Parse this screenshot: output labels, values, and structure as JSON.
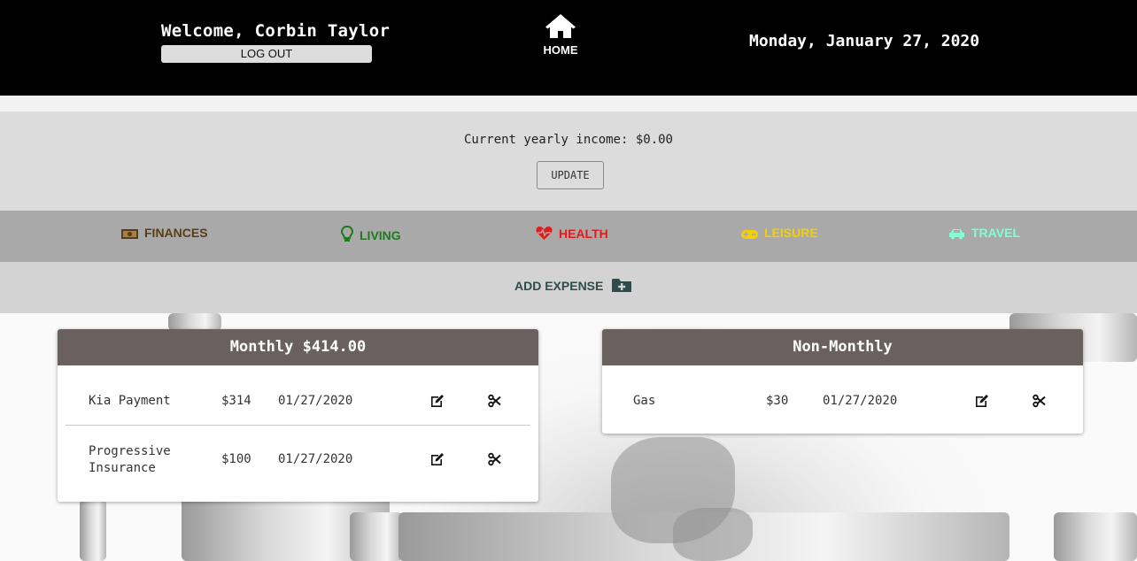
{
  "header": {
    "welcome": "Welcome, Corbin Taylor",
    "logout_label": "LOG OUT",
    "home_label": "HOME",
    "date": "Monday, January 27, 2020"
  },
  "income": {
    "text": "Current yearly income: $0.00",
    "update_label": "UPDATE"
  },
  "categories": [
    {
      "label": "FINANCES",
      "icon": "money-icon",
      "color": "#5a3d14"
    },
    {
      "label": "LIVING",
      "icon": "lightbulb-icon",
      "color": "#1f7a1f"
    },
    {
      "label": "HEALTH",
      "icon": "heartbeat-icon",
      "color": "#e31b1b"
    },
    {
      "label": "LEISURE",
      "icon": "gamepad-icon",
      "color": "#f5d000"
    },
    {
      "label": "TRAVEL",
      "icon": "car-icon",
      "color": "#7fffd4"
    }
  ],
  "add_expense_label": "ADD EXPENSE",
  "monthly": {
    "title": "Monthly $414.00",
    "rows": [
      {
        "name": "Kia Payment",
        "amount": "$314",
        "date": "01/27/2020"
      },
      {
        "name": "Progressive Insurance",
        "amount": "$100",
        "date": "01/27/2020"
      }
    ]
  },
  "non_monthly": {
    "title": "Non-Monthly",
    "rows": [
      {
        "name": "Gas",
        "amount": "$30",
        "date": "01/27/2020"
      }
    ]
  }
}
